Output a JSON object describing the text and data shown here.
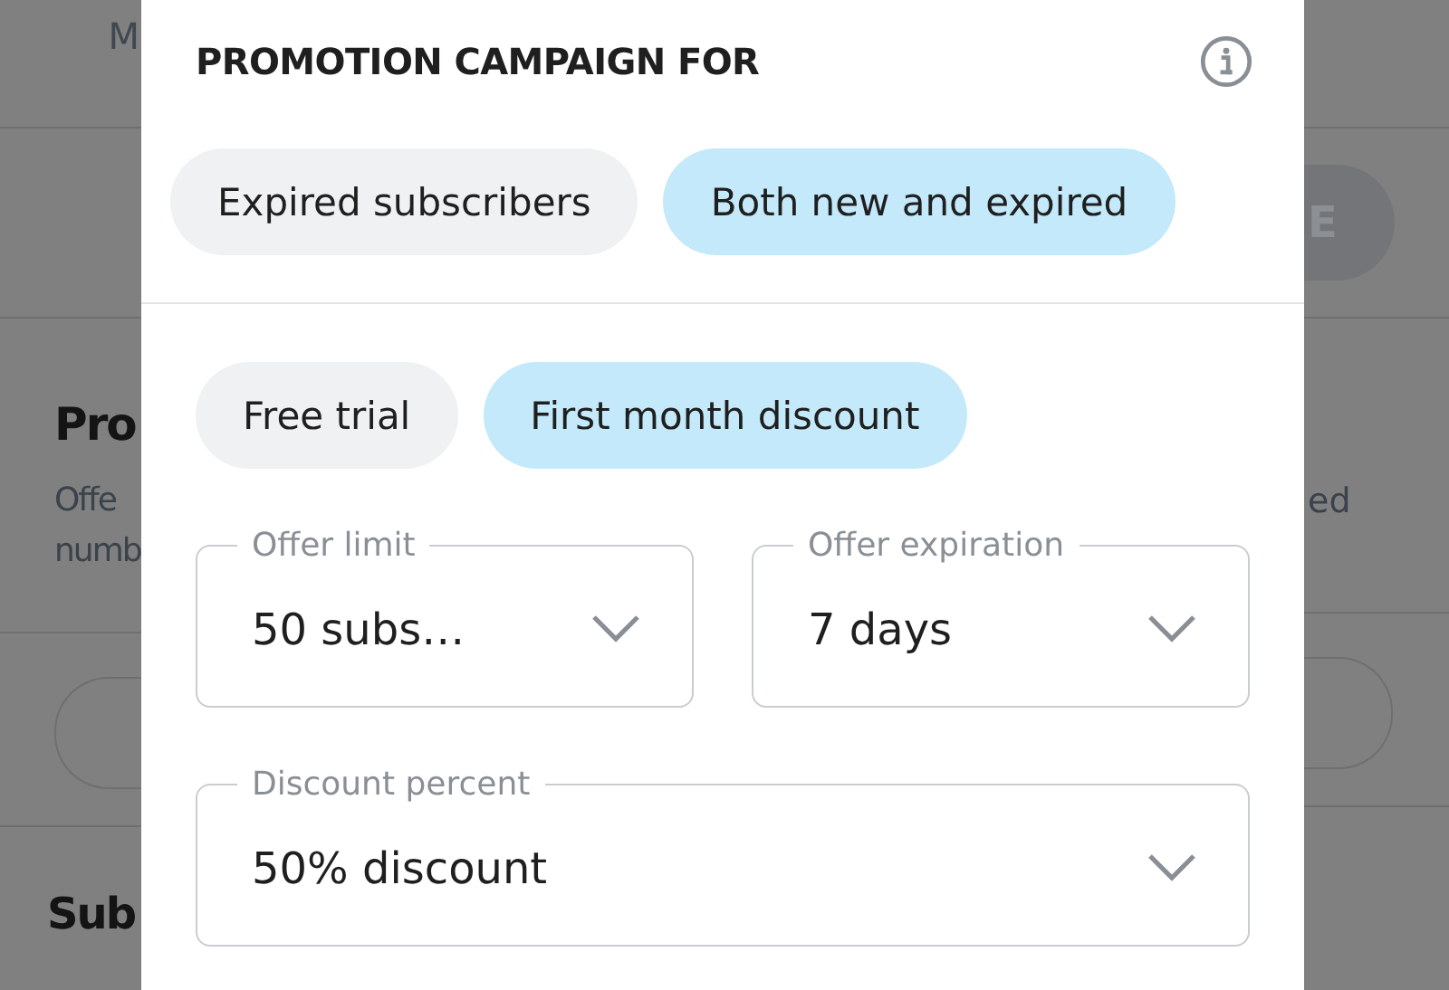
{
  "background": {
    "top_text": "M",
    "heading": "Pro",
    "description_lines": [
      "Offe",
      "numb"
    ],
    "section_heading": "Sub",
    "button": "E",
    "right_text": "ed"
  },
  "dialog": {
    "title": "PROMOTION CAMPAIGN FOR",
    "audience_options": [
      {
        "label": "Expired subscribers",
        "selected": false
      },
      {
        "label": "Both new and expired",
        "selected": true
      }
    ],
    "offer_types": [
      {
        "label": "Free trial",
        "selected": false
      },
      {
        "label": "First month discount",
        "selected": true
      }
    ],
    "field_rows": [
      [
        {
          "label": "Offer limit",
          "value": "50 subs…"
        },
        {
          "label": "Offer expiration",
          "value": "7 days"
        }
      ],
      [
        {
          "label": "Discount percent",
          "value": "50% discount"
        }
      ]
    ]
  }
}
